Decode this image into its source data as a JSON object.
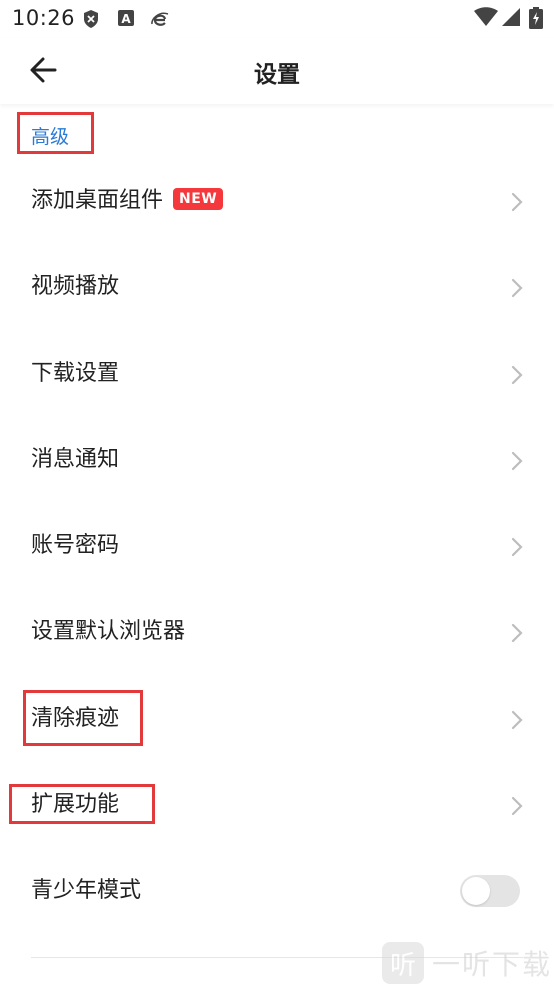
{
  "status_bar": {
    "time": "10:26",
    "icons": [
      "shield-icon",
      "font-a-icon",
      "browser-e-icon"
    ],
    "right_icons": [
      "wifi-icon",
      "signal-icon",
      "battery-charging-icon"
    ],
    "font_icon_letter": "A"
  },
  "header": {
    "title": "设置",
    "back_icon": "arrow-left-icon"
  },
  "section": {
    "title": "高级"
  },
  "items": [
    {
      "label": "添加桌面组件",
      "badge": "NEW",
      "control": "chevron"
    },
    {
      "label": "视频播放",
      "control": "chevron"
    },
    {
      "label": "下载设置",
      "control": "chevron"
    },
    {
      "label": "消息通知",
      "control": "chevron"
    },
    {
      "label": "账号密码",
      "control": "chevron"
    },
    {
      "label": "设置默认浏览器",
      "control": "chevron"
    },
    {
      "label": "清除痕迹",
      "control": "chevron"
    },
    {
      "label": "扩展功能",
      "control": "chevron"
    },
    {
      "label": "青少年模式",
      "control": "toggle",
      "toggle_on": false
    }
  ],
  "watermark": {
    "logo_text": "听",
    "text": "一听下载"
  },
  "colors": {
    "accent": "#2a7bd6",
    "badge": "#f4383c",
    "annotation": "#e23a3a"
  }
}
